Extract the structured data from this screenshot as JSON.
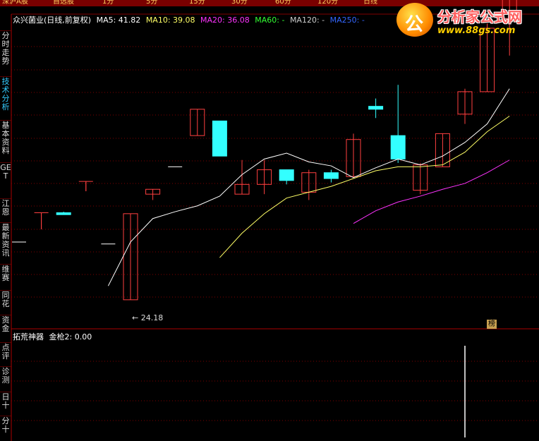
{
  "topbar": {
    "items": [
      "深沪A股",
      "自选股",
      "1分",
      "5分",
      "15分",
      "30分",
      "60分",
      "120分",
      "日线",
      "",
      "",
      ""
    ]
  },
  "sidebar": {
    "items": [
      {
        "label": "分时走势",
        "active": false
      },
      {
        "label": "技术分析",
        "active": true
      },
      {
        "label": "基本资料",
        "active": false
      },
      {
        "label": "GET",
        "active": false
      },
      {
        "label": "江恩",
        "active": false
      },
      {
        "label": "最新资讯",
        "active": false
      },
      {
        "label": "维赛",
        "active": false
      },
      {
        "label": "同花",
        "active": false
      },
      {
        "label": "资金",
        "active": false
      },
      {
        "label": "点评",
        "active": false
      },
      {
        "label": "诊测",
        "active": false
      },
      {
        "label": "日十",
        "active": false
      },
      {
        "label": "分十",
        "active": false
      }
    ]
  },
  "header": {
    "stock": "众兴菌业(日线,前复权)",
    "ma5": "MA5: 41.82",
    "ma10": "MA10: 39.08",
    "ma20": "MA20: 36.08",
    "ma60": "MA60: -",
    "ma120": "MA120: -",
    "ma250": "MA250: -"
  },
  "indicator": {
    "title": "拓荒神器",
    "value": "金枪2: 0.00"
  },
  "logo": {
    "title": "分析家公式网",
    "url": "www.88gs.com",
    "glyph": "公"
  },
  "bang_label": "榜",
  "low_label": "← 24.18",
  "colors": {
    "up": "#ff4040",
    "down": "#33ffff",
    "ma5": "#ffffff",
    "ma10": "#ffff66",
    "ma20": "#ff33ff",
    "ma60": "#33ff33",
    "ma120": "#cccccc",
    "ma250": "#3333ff",
    "grid": "#800000"
  },
  "chart_data": {
    "type": "candlestick",
    "y_range": [
      22,
      52
    ],
    "candles": [
      {
        "o": 30.1,
        "h": 30.1,
        "l": 30.1,
        "c": 30.1
      },
      {
        "o": 33.1,
        "h": 33.1,
        "l": 31.4,
        "c": 33.1
      },
      {
        "o": 33.1,
        "h": 33.2,
        "l": 32.9,
        "c": 32.9
      },
      {
        "o": 36.3,
        "h": 36.3,
        "l": 35.3,
        "c": 36.3
      },
      {
        "o": 29.9,
        "h": 29.9,
        "l": 29.9,
        "c": 29.9
      },
      {
        "o": 24.18,
        "h": 33.0,
        "l": 24.18,
        "c": 33.0
      },
      {
        "o": 35.0,
        "h": 35.5,
        "l": 34.4,
        "c": 35.5
      },
      {
        "o": 37.8,
        "h": 37.8,
        "l": 37.8,
        "c": 37.8
      },
      {
        "o": 41.0,
        "h": 43.7,
        "l": 41.0,
        "c": 43.7
      },
      {
        "o": 42.5,
        "h": 42.5,
        "l": 38.9,
        "c": 38.9
      },
      {
        "o": 35.0,
        "h": 38.5,
        "l": 35.0,
        "c": 36.0
      },
      {
        "o": 36.0,
        "h": 38.5,
        "l": 35.0,
        "c": 37.5
      },
      {
        "o": 37.5,
        "h": 37.5,
        "l": 36.0,
        "c": 36.4
      },
      {
        "o": 35.2,
        "h": 37.5,
        "l": 34.4,
        "c": 37.2
      },
      {
        "o": 37.2,
        "h": 37.5,
        "l": 36.2,
        "c": 36.6
      },
      {
        "o": 36.8,
        "h": 41.2,
        "l": 36.8,
        "c": 40.6
      },
      {
        "o": 44.0,
        "h": 44.8,
        "l": 42.8,
        "c": 43.7
      },
      {
        "o": 41.0,
        "h": 46.2,
        "l": 38.2,
        "c": 38.6
      },
      {
        "o": 35.4,
        "h": 38.2,
        "l": 35.0,
        "c": 38.0
      },
      {
        "o": 37.8,
        "h": 41.2,
        "l": 37.8,
        "c": 41.2
      },
      {
        "o": 43.2,
        "h": 45.8,
        "l": 42.2,
        "c": 45.5
      },
      {
        "o": 45.5,
        "h": 52.5,
        "l": 45.5,
        "c": 52.0
      },
      {
        "o": 53.0,
        "h": 59.0,
        "l": 49.2,
        "c": 58.0
      }
    ],
    "ma5": [
      null,
      null,
      null,
      null,
      25.6,
      30.1,
      32.5,
      33.2,
      33.8,
      34.8,
      37.0,
      38.6,
      39.2,
      38.3,
      37.9,
      36.7,
      37.7,
      38.6,
      38.0,
      38.9,
      40.3,
      42.2,
      45.8
    ],
    "ma10": [
      null,
      null,
      null,
      null,
      null,
      null,
      null,
      null,
      null,
      28.5,
      31.0,
      33.0,
      34.6,
      35.2,
      35.8,
      36.6,
      37.4,
      37.8,
      37.8,
      38.0,
      39.3,
      41.4,
      43.0
    ],
    "ma20": [
      null,
      null,
      null,
      null,
      null,
      null,
      null,
      null,
      null,
      null,
      null,
      null,
      null,
      null,
      null,
      32.0,
      33.3,
      34.2,
      34.8,
      35.5,
      36.1,
      37.2,
      38.5
    ],
    "indicator_bars": [
      0,
      0,
      0,
      0,
      0,
      0,
      0,
      0,
      0,
      0,
      0,
      0,
      0,
      0,
      0,
      0,
      0,
      0,
      0,
      0,
      1,
      0,
      0
    ],
    "indicator_label": "金枪2"
  }
}
